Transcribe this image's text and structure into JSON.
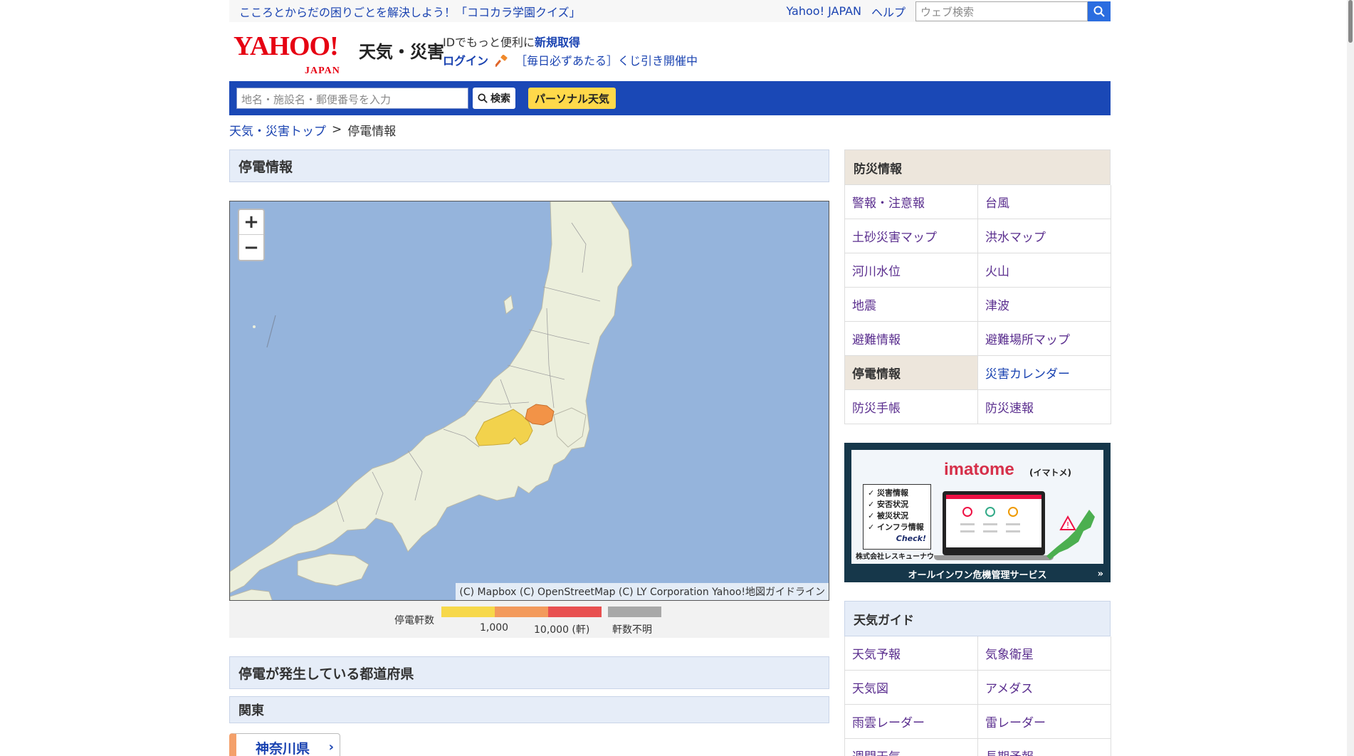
{
  "topbar": {
    "promo": "こころとからだの困りごとを解決しよう！「ココカラ学園クイズ」",
    "yahoo_japan": "Yahoo! JAPAN",
    "help": "ヘルプ",
    "web_search_placeholder": "ウェブ検索"
  },
  "header": {
    "logo_text": "YAHOO!",
    "logo_sub_jp": "JAPAN",
    "service_name": "天気・災害",
    "id_text": "IDでもっと便利に",
    "signup": "新規取得",
    "login": "ログイン",
    "lottery": "［毎日必ずあたる］くじ引き開催中"
  },
  "search": {
    "placeholder": "地名・施設名・郵便番号を入力",
    "button": "検索",
    "personal": "パーソナル天気"
  },
  "breadcrumb": {
    "top": "天気・災害トップ",
    "sep": ">",
    "current": "停電情報"
  },
  "main": {
    "title": "停電情報",
    "map_attribution": "(C) Mapbox (C) OpenStreetMap (C) LY Corporation Yahoo!地図ガイドライン",
    "zoom_in": "+",
    "zoom_out": "−",
    "legend": {
      "title": "停電軒数",
      "tick1": "1,000",
      "tick2": "10,000 (軒)",
      "unknown": "軒数不明",
      "colors": [
        "#f7d84a",
        "#f39a5c",
        "#e85050",
        "#a8a8a8"
      ]
    },
    "pref_section_title": "停電が発生している都道府県",
    "region": "関東",
    "prefecture": "神奈川県",
    "affected_colors": {
      "kanagawa": "#f29347",
      "shizuoka": "#f2d24c"
    }
  },
  "sidebar": {
    "bousai_title": "防災情報",
    "bousai_items": [
      {
        "label": "警報・注意報",
        "state": "visited"
      },
      {
        "label": "台風",
        "state": "visited"
      },
      {
        "label": "土砂災害マップ",
        "state": "visited"
      },
      {
        "label": "洪水マップ",
        "state": "visited"
      },
      {
        "label": "河川水位",
        "state": "visited"
      },
      {
        "label": "火山",
        "state": "visited"
      },
      {
        "label": "地震",
        "state": "visited"
      },
      {
        "label": "津波",
        "state": "visited"
      },
      {
        "label": "避難情報",
        "state": "visited"
      },
      {
        "label": "避難場所マップ",
        "state": "visited"
      },
      {
        "label": "停電情報",
        "state": "active"
      },
      {
        "label": "災害カレンダー",
        "state": "link"
      },
      {
        "label": "防災手帳",
        "state": "visited"
      },
      {
        "label": "防災速報",
        "state": "visited"
      }
    ],
    "banner": {
      "brand": "imatome",
      "brand_sub": "(イマトメ)",
      "checklist": [
        "✓ 災害情報",
        "✓ 安否状況",
        "✓ 被災状況",
        "✓ インフラ情報"
      ],
      "check": "Check!",
      "company": "株式会社レスキューナウ",
      "footer": "オールインワン危機管理サービス",
      "arrow": "»"
    },
    "weather_title": "天気ガイド",
    "weather_items": [
      {
        "label": "天気予報",
        "state": "visited"
      },
      {
        "label": "気象衛星",
        "state": "visited"
      },
      {
        "label": "天気図",
        "state": "visited"
      },
      {
        "label": "アメダス",
        "state": "visited"
      },
      {
        "label": "雨雲レーダー",
        "state": "visited"
      },
      {
        "label": "雷レーダー",
        "state": "visited"
      },
      {
        "label": "週間天気",
        "state": "visited"
      },
      {
        "label": "長期予報",
        "state": "visited"
      }
    ]
  }
}
